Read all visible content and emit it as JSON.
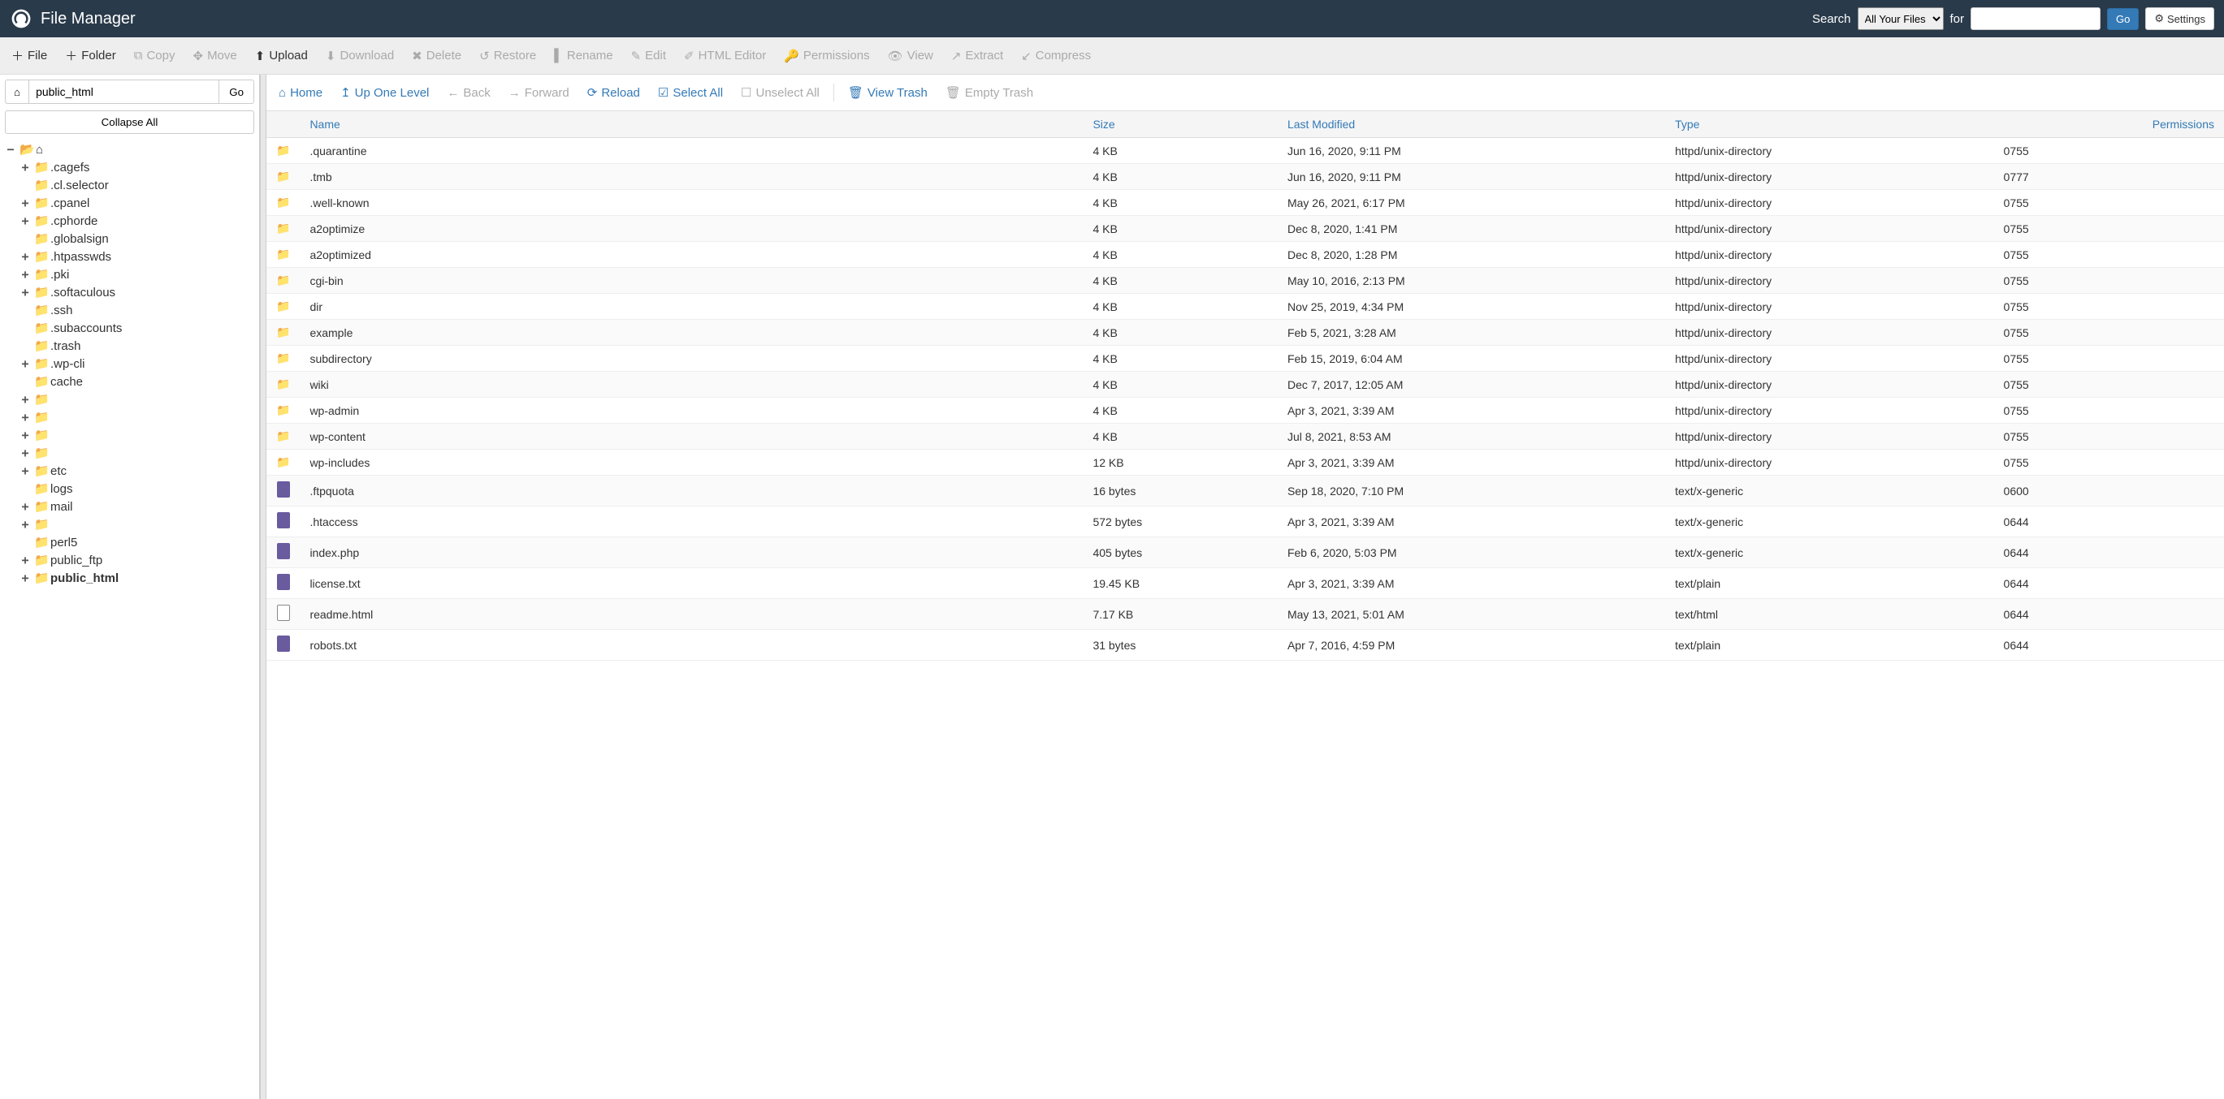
{
  "header": {
    "title": "File Manager",
    "search_label": "Search",
    "search_for_label": "for",
    "search_scope": "All Your Files",
    "go_label": "Go",
    "settings_label": "Settings"
  },
  "toolbar": {
    "file": "File",
    "folder": "Folder",
    "copy": "Copy",
    "move": "Move",
    "upload": "Upload",
    "download": "Download",
    "delete": "Delete",
    "restore": "Restore",
    "rename": "Rename",
    "edit": "Edit",
    "html_editor": "HTML Editor",
    "permissions": "Permissions",
    "view": "View",
    "extract": "Extract",
    "compress": "Compress"
  },
  "sidebar": {
    "path_value": "public_html",
    "go_label": "Go",
    "collapse_label": "Collapse All",
    "tree": [
      {
        "label": ".cagefs",
        "expandable": true
      },
      {
        "label": ".cl.selector",
        "expandable": false
      },
      {
        "label": ".cpanel",
        "expandable": true
      },
      {
        "label": ".cphorde",
        "expandable": true
      },
      {
        "label": ".globalsign",
        "expandable": false
      },
      {
        "label": ".htpasswds",
        "expandable": true
      },
      {
        "label": ".pki",
        "expandable": true
      },
      {
        "label": ".softaculous",
        "expandable": true
      },
      {
        "label": ".ssh",
        "expandable": false
      },
      {
        "label": ".subaccounts",
        "expandable": false
      },
      {
        "label": ".trash",
        "expandable": false
      },
      {
        "label": ".wp-cli",
        "expandable": true
      },
      {
        "label": "cache",
        "expandable": false
      },
      {
        "label": "",
        "expandable": true
      },
      {
        "label": "",
        "expandable": true
      },
      {
        "label": "",
        "expandable": true
      },
      {
        "label": "",
        "expandable": true
      },
      {
        "label": "etc",
        "expandable": true
      },
      {
        "label": "logs",
        "expandable": false
      },
      {
        "label": "mail",
        "expandable": true
      },
      {
        "label": "",
        "expandable": true
      },
      {
        "label": "perl5",
        "expandable": false
      },
      {
        "label": "public_ftp",
        "expandable": true
      },
      {
        "label": "public_html",
        "expandable": true,
        "bold": true
      }
    ]
  },
  "nav": {
    "home": "Home",
    "up": "Up One Level",
    "back": "Back",
    "forward": "Forward",
    "reload": "Reload",
    "select_all": "Select All",
    "unselect_all": "Unselect All",
    "view_trash": "View Trash",
    "empty_trash": "Empty Trash"
  },
  "columns": {
    "name": "Name",
    "size": "Size",
    "modified": "Last Modified",
    "type": "Type",
    "permissions": "Permissions"
  },
  "files": [
    {
      "icon": "folder",
      "name": ".quarantine",
      "size": "4 KB",
      "modified": "Jun 16, 2020, 9:11 PM",
      "type": "httpd/unix-directory",
      "perm": "0755"
    },
    {
      "icon": "folder",
      "name": ".tmb",
      "size": "4 KB",
      "modified": "Jun 16, 2020, 9:11 PM",
      "type": "httpd/unix-directory",
      "perm": "0777"
    },
    {
      "icon": "folder",
      "name": ".well-known",
      "size": "4 KB",
      "modified": "May 26, 2021, 6:17 PM",
      "type": "httpd/unix-directory",
      "perm": "0755"
    },
    {
      "icon": "folder",
      "name": "a2optimize",
      "size": "4 KB",
      "modified": "Dec 8, 2020, 1:41 PM",
      "type": "httpd/unix-directory",
      "perm": "0755"
    },
    {
      "icon": "folder",
      "name": "a2optimized",
      "size": "4 KB",
      "modified": "Dec 8, 2020, 1:28 PM",
      "type": "httpd/unix-directory",
      "perm": "0755"
    },
    {
      "icon": "folder",
      "name": "cgi-bin",
      "size": "4 KB",
      "modified": "May 10, 2016, 2:13 PM",
      "type": "httpd/unix-directory",
      "perm": "0755"
    },
    {
      "icon": "folder",
      "name": "dir",
      "size": "4 KB",
      "modified": "Nov 25, 2019, 4:34 PM",
      "type": "httpd/unix-directory",
      "perm": "0755"
    },
    {
      "icon": "folder",
      "name": "example",
      "size": "4 KB",
      "modified": "Feb 5, 2021, 3:28 AM",
      "type": "httpd/unix-directory",
      "perm": "0755"
    },
    {
      "icon": "folder",
      "name": "subdirectory",
      "size": "4 KB",
      "modified": "Feb 15, 2019, 6:04 AM",
      "type": "httpd/unix-directory",
      "perm": "0755"
    },
    {
      "icon": "folder",
      "name": "wiki",
      "size": "4 KB",
      "modified": "Dec 7, 2017, 12:05 AM",
      "type": "httpd/unix-directory",
      "perm": "0755"
    },
    {
      "icon": "folder",
      "name": "wp-admin",
      "size": "4 KB",
      "modified": "Apr 3, 2021, 3:39 AM",
      "type": "httpd/unix-directory",
      "perm": "0755"
    },
    {
      "icon": "folder",
      "name": "wp-content",
      "size": "4 KB",
      "modified": "Jul 8, 2021, 8:53 AM",
      "type": "httpd/unix-directory",
      "perm": "0755"
    },
    {
      "icon": "folder",
      "name": "wp-includes",
      "size": "12 KB",
      "modified": "Apr 3, 2021, 3:39 AM",
      "type": "httpd/unix-directory",
      "perm": "0755"
    },
    {
      "icon": "file",
      "name": ".ftpquota",
      "size": "16 bytes",
      "modified": "Sep 18, 2020, 7:10 PM",
      "type": "text/x-generic",
      "perm": "0600"
    },
    {
      "icon": "file",
      "name": ".htaccess",
      "size": "572 bytes",
      "modified": "Apr 3, 2021, 3:39 AM",
      "type": "text/x-generic",
      "perm": "0644"
    },
    {
      "icon": "file",
      "name": "index.php",
      "size": "405 bytes",
      "modified": "Feb 6, 2020, 5:03 PM",
      "type": "text/x-generic",
      "perm": "0644"
    },
    {
      "icon": "file",
      "name": "license.txt",
      "size": "19.45 KB",
      "modified": "Apr 3, 2021, 3:39 AM",
      "type": "text/plain",
      "perm": "0644"
    },
    {
      "icon": "html",
      "name": "readme.html",
      "size": "7.17 KB",
      "modified": "May 13, 2021, 5:01 AM",
      "type": "text/html",
      "perm": "0644"
    },
    {
      "icon": "file",
      "name": "robots.txt",
      "size": "31 bytes",
      "modified": "Apr 7, 2016, 4:59 PM",
      "type": "text/plain",
      "perm": "0644"
    }
  ]
}
